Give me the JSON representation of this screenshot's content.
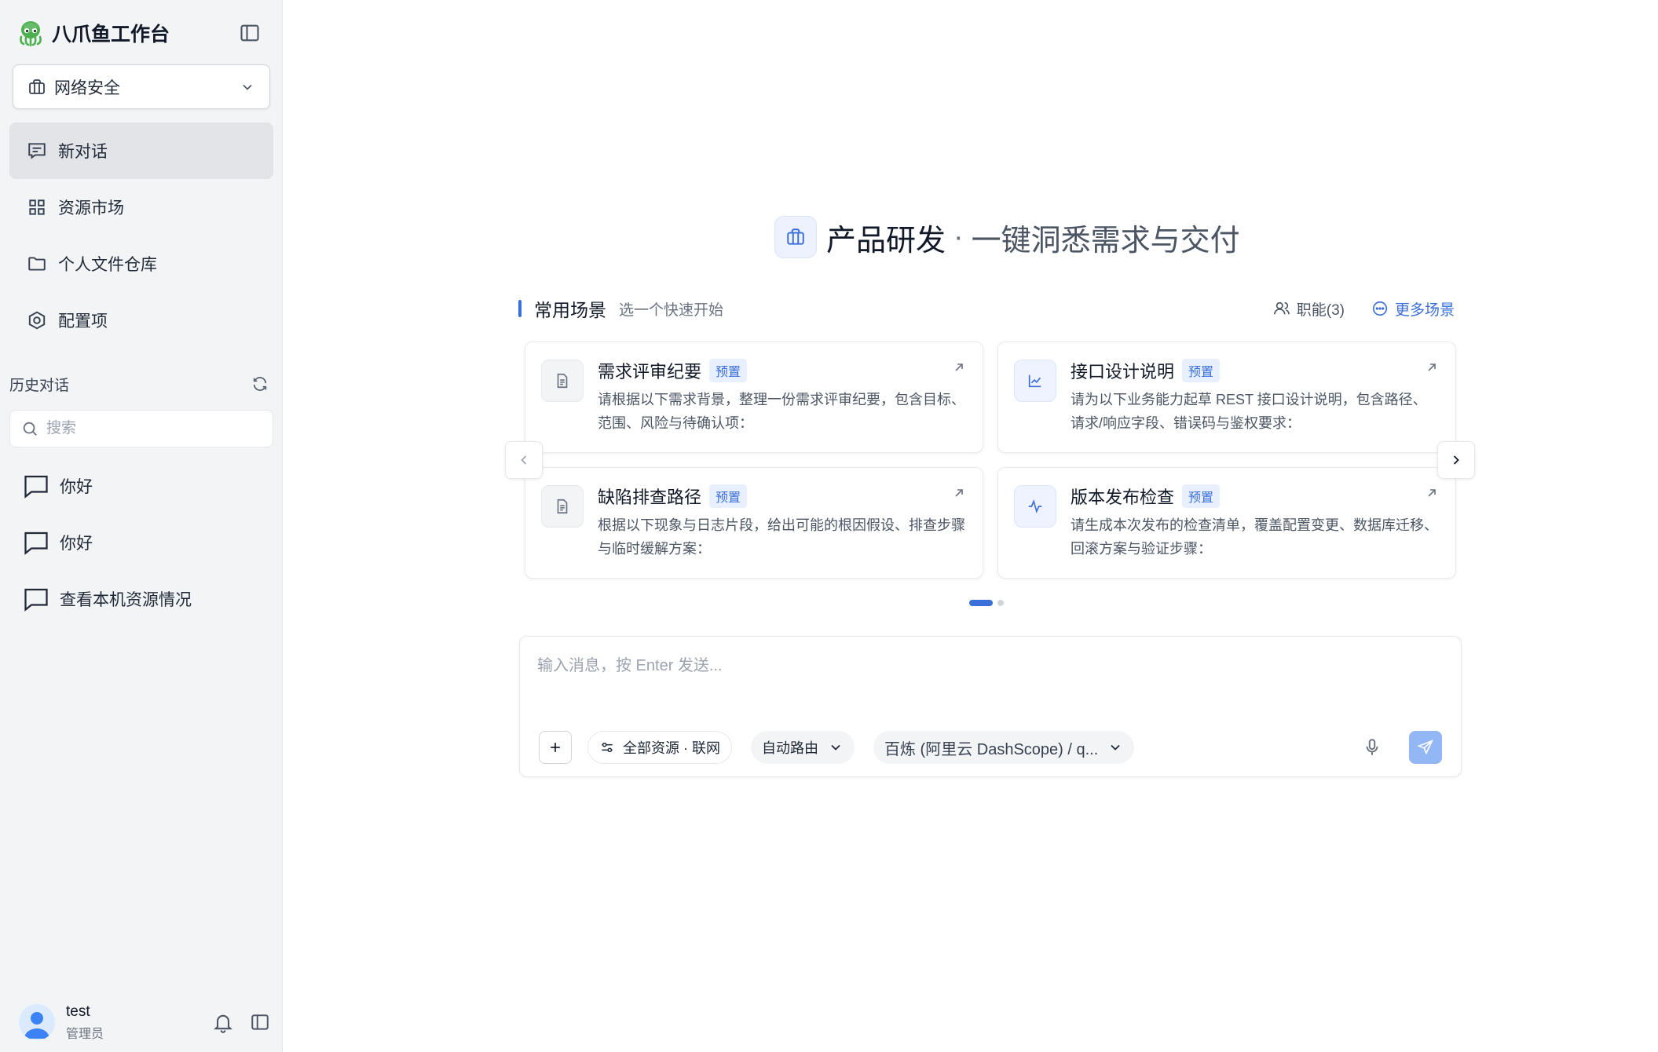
{
  "brand": {
    "name": "八爪鱼工作台"
  },
  "workspace": {
    "label": "网络安全"
  },
  "nav": [
    {
      "label": "新对话",
      "icon": "chat-icon",
      "active": true
    },
    {
      "label": "资源市场",
      "icon": "grid-icon"
    },
    {
      "label": "个人文件仓库",
      "icon": "folder-icon"
    },
    {
      "label": "配置项",
      "icon": "settings-icon"
    }
  ],
  "history": {
    "title": "历史对话",
    "search_placeholder": "搜索",
    "items": [
      "你好",
      "你好",
      "查看本机资源情况"
    ]
  },
  "user": {
    "name": "test",
    "role": "管理员"
  },
  "hero": {
    "title": "产品研发",
    "separator": "·",
    "subtitle": "一键洞悉需求与交付"
  },
  "scenes": {
    "title": "常用场景",
    "subtitle": "选一个快速开始",
    "roles_label": "职能(3)",
    "more_label": "更多场景",
    "tag": "预置",
    "cards": [
      {
        "title": "需求评审纪要",
        "desc": "请根据以下需求背景，整理一份需求评审纪要，包含目标、范围、风险与待确认项：",
        "icon": "document-icon"
      },
      {
        "title": "接口设计说明",
        "desc": "请为以下业务能力起草 REST 接口设计说明，包含路径、请求/响应字段、错误码与鉴权要求：",
        "icon": "line-chart-icon"
      },
      {
        "title": "缺陷排查路径",
        "desc": "根据以下现象与日志片段，给出可能的根因假设、排查步骤与临时缓解方案：",
        "icon": "document-icon"
      },
      {
        "title": "版本发布检查",
        "desc": "请生成本次发布的检查清单，覆盖配置变更、数据库迁移、回滚方案与验证步骤：",
        "icon": "activity-icon"
      }
    ],
    "pages": 2,
    "current_page": 1
  },
  "composer": {
    "placeholder": "输入消息，按 Enter 发送...",
    "resources_label": "全部资源 · 联网",
    "routing_label": "自动路由",
    "model_label": "百炼 (阿里云 DashScope) / q..."
  },
  "colors": {
    "accent": "#3b6fd8",
    "send_button": "#93b6f5",
    "sidebar_bg": "#f3f4f6"
  }
}
